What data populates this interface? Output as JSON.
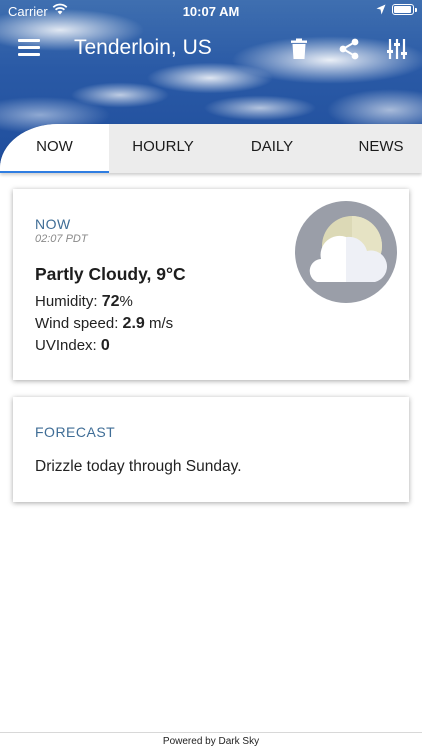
{
  "status_bar": {
    "carrier": "Carrier",
    "time": "10:07 AM"
  },
  "nav": {
    "title": "Tenderloin, US",
    "icons": [
      "menu-icon",
      "trash-icon",
      "share-icon",
      "settings-sliders-icon"
    ]
  },
  "tabs": [
    {
      "label": "NOW",
      "active": true
    },
    {
      "label": "HOURLY",
      "active": false
    },
    {
      "label": "DAILY",
      "active": false
    },
    {
      "label": "NEWS",
      "active": false
    }
  ],
  "now": {
    "label": "NOW",
    "time": "02:07 PDT",
    "condition": "Partly Cloudy, 9°C",
    "humidity_label": "Humidity: ",
    "humidity_value": "72",
    "humidity_unit": "%",
    "wind_label": "Wind speed: ",
    "wind_value": "2.9",
    "wind_unit": " m/s",
    "uv_label": "UVIndex: ",
    "uv_value": "0",
    "icon": "partly-cloudy-icon"
  },
  "forecast": {
    "label": "FORECAST",
    "text": "Drizzle today through Sunday."
  },
  "footer": {
    "text": "Powered by Dark Sky"
  },
  "colors": {
    "accent": "#2f7de1",
    "label": "#3f6d96",
    "tab_bg": "#ececec",
    "sky": "#2a5aa6"
  }
}
